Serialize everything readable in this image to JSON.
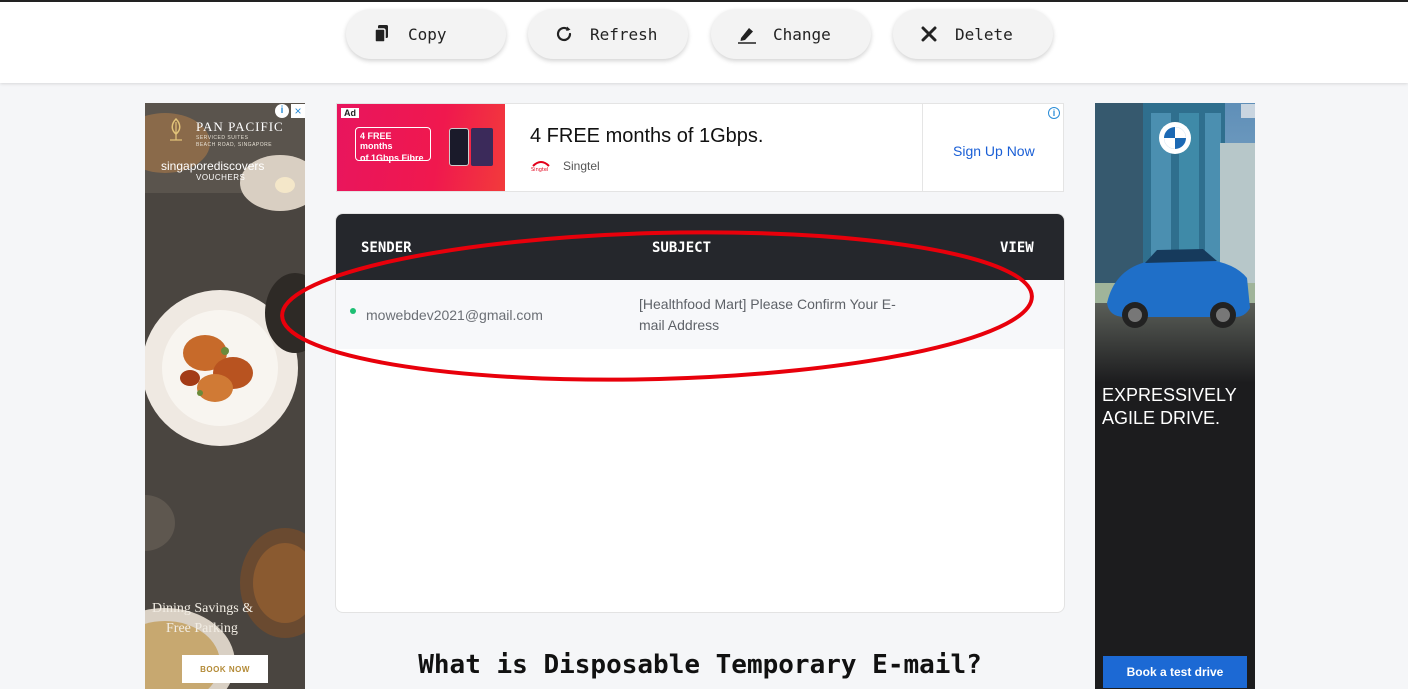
{
  "toolbar": {
    "copy_label": "Copy",
    "refresh_label": "Refresh",
    "change_label": "Change",
    "delete_label": "Delete"
  },
  "ad_top": {
    "badge": "Ad",
    "banner_line1": "4 FREE months",
    "banner_line2": "of 1Gbps Fibre",
    "headline": "4 FREE months of 1Gbps.",
    "advertiser": "Singtel",
    "cta": "Sign Up Now"
  },
  "ad_left": {
    "brand": "PAN PACIFIC",
    "brand_sub1": "SERVICED SUITES",
    "brand_sub2": "BEACH ROAD, SINGAPORE",
    "campaign": "singaporediscovers",
    "campaign_sub": "VOUCHERS",
    "tagline1": "Dining Savings &",
    "tagline2": "Free Parking",
    "cta": "BOOK NOW"
  },
  "ad_right": {
    "headline1": "EXPRESSIVELY",
    "headline2": "AGILE DRIVE.",
    "cta": "Book a test drive"
  },
  "inbox": {
    "columns": [
      "SENDER",
      "SUBJECT",
      "VIEW"
    ],
    "rows": [
      {
        "sender": "mowebdev2021@gmail.com",
        "subject": "[Healthfood Mart] Please Confirm Your E-mail Address"
      }
    ]
  },
  "section": {
    "heading": "What is Disposable Temporary E-mail?"
  },
  "colors": {
    "header_bg": "#25272c",
    "unread_dot": "#1dbf73",
    "annotation": "#e8000b",
    "cta_blue": "#1a5fd6"
  }
}
